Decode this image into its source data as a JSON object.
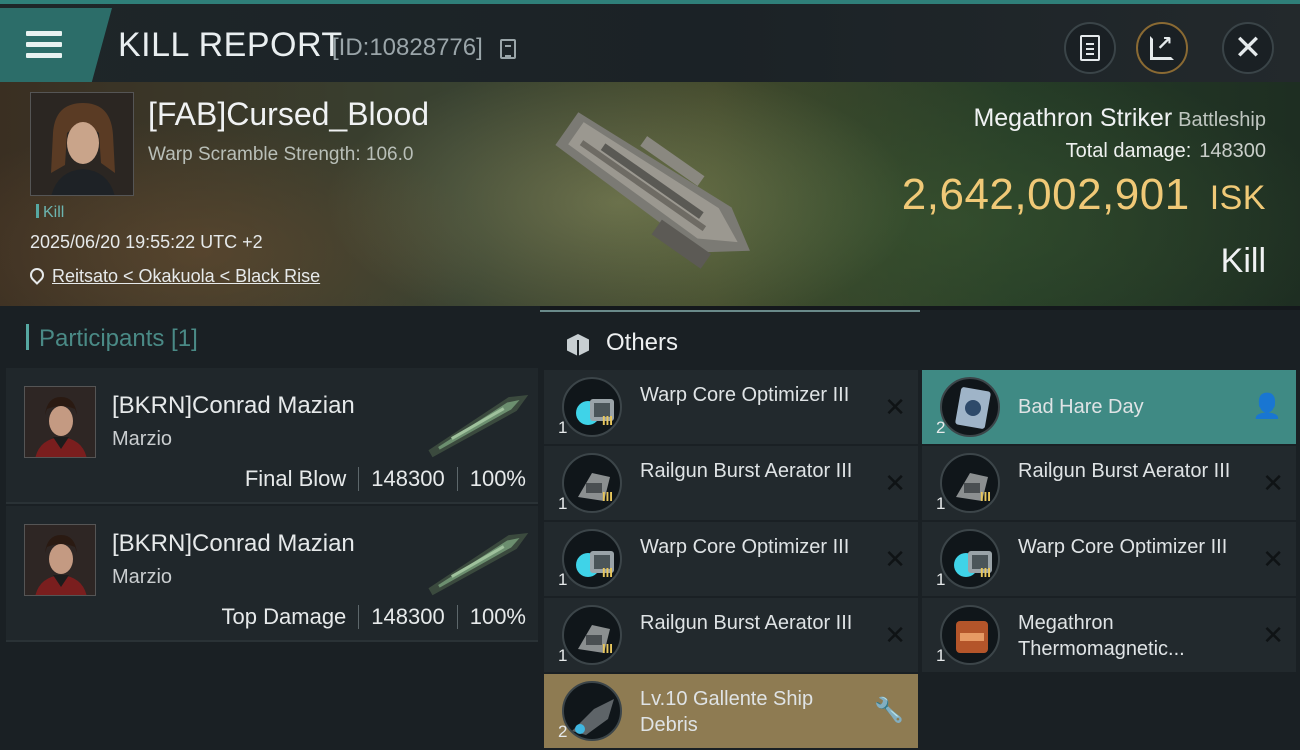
{
  "header": {
    "title": "KILL REPORT",
    "report_id": "[ID:10828776]",
    "menu_icon": "hamburger-menu-icon",
    "buttons": [
      {
        "name": "clipboard",
        "icon": "clipboard-icon"
      },
      {
        "name": "share",
        "icon": "share-icon"
      },
      {
        "name": "close",
        "icon": "close-icon"
      }
    ]
  },
  "victim": {
    "name": "[FAB]Cursed_Blood",
    "warp_scramble": "Warp Scramble Strength: 106.0",
    "tag": "Kill",
    "timestamp": "2025/06/20 19:55:22 UTC +2",
    "location": "Reitsato < Okakuola < Black Rise",
    "ship_name": "Megathron Striker",
    "ship_class": "Battleship",
    "total_damage_label": "Total damage:",
    "total_damage": "148300",
    "isk_value": "2,642,002,901",
    "isk_unit": "ISK",
    "result": "Kill"
  },
  "participants": {
    "title": "Participants [1]",
    "rows": [
      {
        "name": "[BKRN]Conrad Mazian",
        "corp": "Marzio",
        "role": "Final Blow",
        "damage": "148300",
        "percent": "100%"
      },
      {
        "name": "[BKRN]Conrad Mazian",
        "corp": "Marzio",
        "role": "Top Damage",
        "damage": "148300",
        "percent": "100%"
      }
    ]
  },
  "others": {
    "title": "Others",
    "left": [
      {
        "name": "Warp Core Optimizer III",
        "qty": "1",
        "lvl": "III",
        "icon": "warp-core-optimizer-icon",
        "status": "destroyed"
      },
      {
        "name": "Railgun Burst Aerator III",
        "qty": "1",
        "lvl": "III",
        "icon": "railgun-burst-aerator-icon",
        "status": "destroyed"
      },
      {
        "name": "Warp Core Optimizer III",
        "qty": "1",
        "lvl": "III",
        "icon": "warp-core-optimizer-icon",
        "status": "destroyed"
      },
      {
        "name": "Railgun Burst Aerator III",
        "qty": "1",
        "lvl": "III",
        "icon": "railgun-burst-aerator-icon",
        "status": "destroyed"
      },
      {
        "name": "Lv.10 Gallente Ship Debris",
        "qty": "2",
        "lvl": "",
        "icon": "ship-debris-icon",
        "status": "dropped"
      }
    ],
    "right": [
      {
        "name": "Bad Hare Day",
        "qty": "2",
        "lvl": "",
        "icon": "blueprint-card-icon",
        "status": "dropped-personal"
      },
      {
        "name": "Railgun Burst Aerator III",
        "qty": "1",
        "lvl": "III",
        "icon": "railgun-burst-aerator-icon",
        "status": "destroyed"
      },
      {
        "name": "Warp Core Optimizer III",
        "qty": "1",
        "lvl": "III",
        "icon": "warp-core-optimizer-icon",
        "status": "destroyed"
      },
      {
        "name": "Megathron Thermomagnetic...",
        "qty": "1",
        "lvl": "",
        "icon": "thermomagnetic-module-icon",
        "status": "destroyed"
      }
    ]
  },
  "colors": {
    "accent_teal": "#3f8a84",
    "isk_gold": "#f0c977",
    "dropped_gold": "#8e7b52"
  }
}
